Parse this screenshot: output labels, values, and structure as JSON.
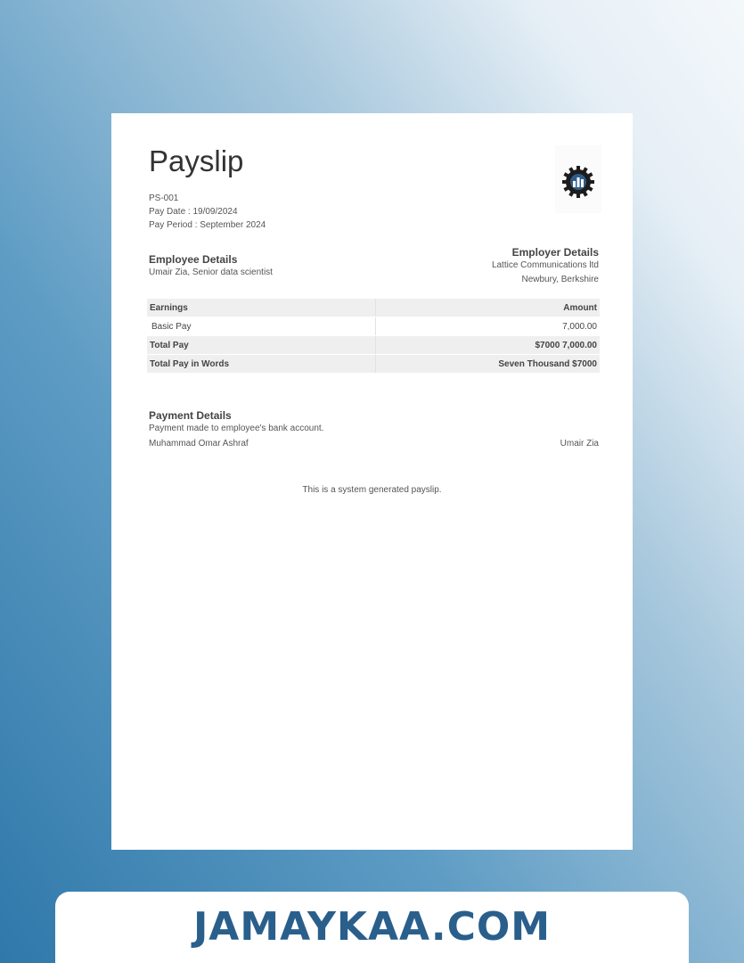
{
  "payslip": {
    "title": "Payslip",
    "number": "PS-001",
    "pay_date": "Pay Date : 19/09/2024",
    "pay_period": "Pay Period : September 2024"
  },
  "employee": {
    "heading": "Employee Details",
    "text": "Umair Zia, Senior data scientist"
  },
  "employer": {
    "heading": "Employer Details",
    "name": "Lattice Communications ltd",
    "location": "Newbury, Berkshire"
  },
  "earnings_table": {
    "headers": [
      "Earnings",
      "Amount"
    ],
    "rows": [
      {
        "label": "Basic Pay",
        "value": "7,000.00"
      },
      {
        "label": "Total Pay",
        "value": "$7000 7,000.00"
      },
      {
        "label": "Total Pay in Words",
        "value": "Seven Thousand $7000"
      }
    ]
  },
  "payment": {
    "heading": "Payment Details",
    "text": "Payment made to employee's bank account.",
    "signatory_left": "Muhammad Omar Ashraf",
    "signatory_right": "Umair Zia"
  },
  "footer_note": "This is a system generated payslip.",
  "banner": {
    "text": "JAMAYKAA.COM"
  },
  "colors": {
    "banner_text": "#2a5f8c",
    "table_shade": "#efefef"
  },
  "icons": {
    "logo": "gear-chart-logo-icon"
  }
}
